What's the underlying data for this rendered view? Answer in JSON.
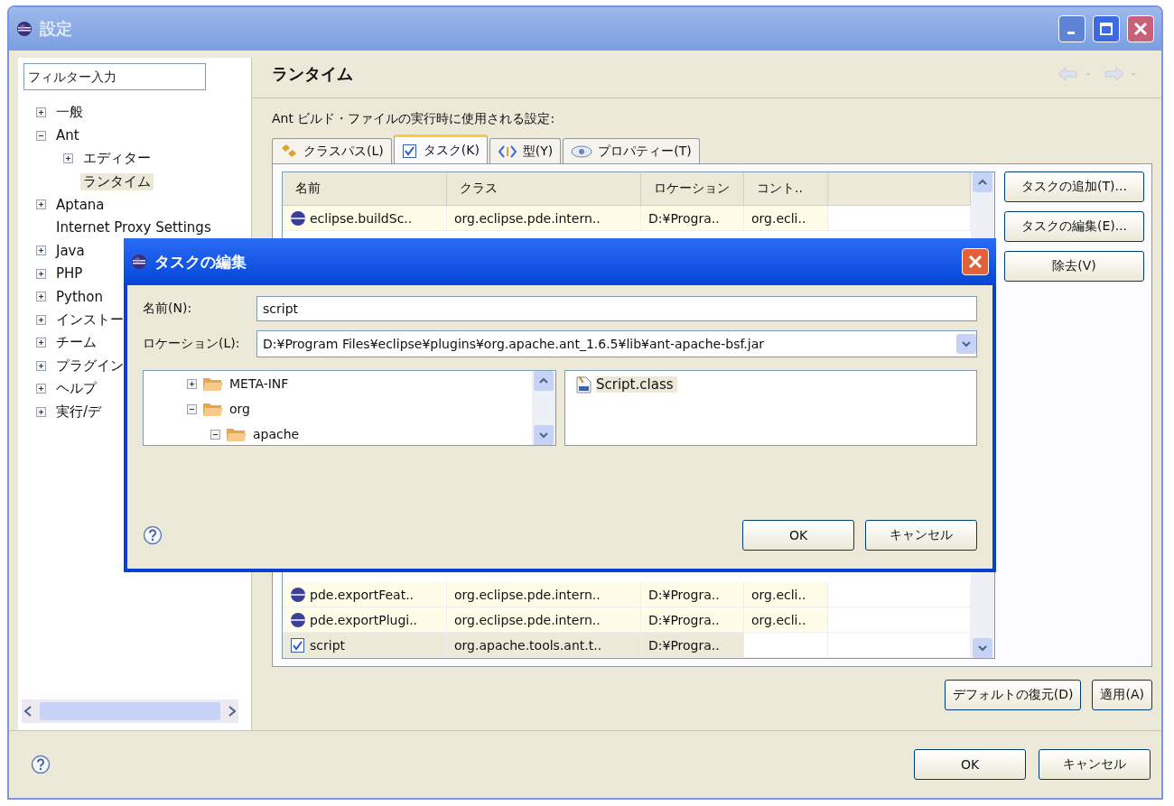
{
  "window": {
    "title": "設定"
  },
  "filter": {
    "placeholder": "フィルター入力"
  },
  "sidebar": {
    "items": [
      {
        "label": "一般",
        "expanded": false,
        "selected": false
      },
      {
        "label": "Ant",
        "expanded": true,
        "selected": false,
        "children": [
          {
            "label": "エディター",
            "expanded": false,
            "selected": false
          },
          {
            "label": "ランタイム",
            "selected": true
          }
        ]
      },
      {
        "label": "Aptana",
        "expanded": false,
        "selected": false
      },
      {
        "label": "Internet Proxy Settings",
        "selected": false
      },
      {
        "label": "Java",
        "expanded": false,
        "selected": false
      },
      {
        "label": "PHP",
        "expanded": false,
        "selected": false
      },
      {
        "label": "Python",
        "expanded": false,
        "selected": false
      },
      {
        "label": "インストー",
        "expanded": false,
        "selected": false
      },
      {
        "label": "チーム",
        "expanded": false,
        "selected": false
      },
      {
        "label": "プラグイン",
        "expanded": false,
        "selected": false
      },
      {
        "label": "ヘルプ",
        "expanded": false,
        "selected": false
      },
      {
        "label": "実行/デ",
        "expanded": false,
        "selected": false
      }
    ]
  },
  "page": {
    "title": "ランタイム",
    "description": "Ant ビルド・ファイルの実行時に使用される設定:"
  },
  "tabs": [
    {
      "label": "クラスパス(L)",
      "selected": false
    },
    {
      "label": "タスク(K)",
      "selected": true
    },
    {
      "label": "型(Y)",
      "selected": false
    },
    {
      "label": "プロパティー(T)",
      "selected": false
    }
  ],
  "table": {
    "columns": [
      "名前",
      "クラス",
      "ロケーション",
      "コント.."
    ],
    "rows": [
      {
        "kind": "plugin",
        "selected": false,
        "cells": [
          "eclipse.buildSc..",
          "org.eclipse.pde.intern..",
          "D:¥Progra..",
          "org.ecli.."
        ]
      },
      {
        "kind": "plugin",
        "selected": false,
        "cells": [
          "pde.exportFeat..",
          "org.eclipse.pde.intern..",
          "D:¥Progra..",
          "org.ecli.."
        ]
      },
      {
        "kind": "plugin",
        "selected": false,
        "cells": [
          "pde.exportPlugi..",
          "org.eclipse.pde.intern..",
          "D:¥Progra..",
          "org.ecli.."
        ]
      },
      {
        "kind": "user",
        "selected": true,
        "cells": [
          "script",
          "org.apache.tools.ant.t..",
          "D:¥Progra..",
          ""
        ]
      }
    ]
  },
  "side_buttons": [
    "タスクの追加(T)...",
    "タスクの編集(E)...",
    "除去(V)"
  ],
  "page_buttons": [
    "デフォルトの復元(D)",
    "適用(A)"
  ],
  "dialog_buttons": [
    "OK",
    "キャンセル"
  ],
  "edit_dialog": {
    "title": "タスクの編集",
    "name": {
      "label": "名前(N):",
      "value": "script"
    },
    "location": {
      "label": "ロケーション(L):",
      "value": "D:¥Program Files¥eclipse¥plugins¥org.apache.ant_1.6.5¥lib¥ant-apache-bsf.jar"
    },
    "packages": [
      {
        "label": "META-INF",
        "expanded": false
      },
      {
        "label": "org",
        "expanded": true,
        "children": [
          {
            "label": "apache",
            "expanded": true
          }
        ]
      }
    ],
    "classes": [
      {
        "label": "Script.class",
        "selected": true
      }
    ],
    "buttons": [
      "OK",
      "キャンセル"
    ]
  }
}
